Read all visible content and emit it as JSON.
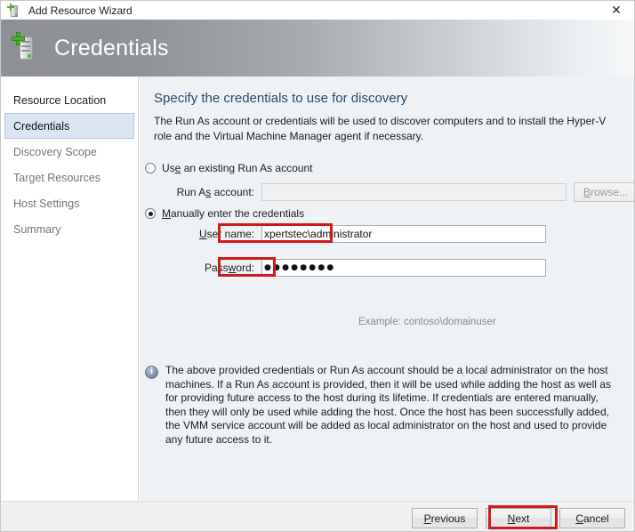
{
  "titlebar": {
    "title": "Add Resource Wizard",
    "icon": "server-add-icon",
    "close_label": "✕"
  },
  "header": {
    "title": "Credentials",
    "icon": "server-add-icon"
  },
  "sidebar": {
    "items": [
      {
        "label": "Resource Location",
        "state": "done"
      },
      {
        "label": "Credentials",
        "state": "selected"
      },
      {
        "label": "Discovery Scope",
        "state": "upcoming"
      },
      {
        "label": "Target Resources",
        "state": "upcoming"
      },
      {
        "label": "Host Settings",
        "state": "upcoming"
      },
      {
        "label": "Summary",
        "state": "upcoming"
      }
    ]
  },
  "main": {
    "heading": "Specify the credentials to use for discovery",
    "description": "The Run As account or credentials will be used to discover computers and to install the Hyper-V role and the Virtual Machine Manager agent if necessary.",
    "option_existing": {
      "label_before": "Us",
      "label_accel": "e",
      "label_after": " an existing Run As account",
      "checked": false
    },
    "runas": {
      "label_before": "Run A",
      "label_accel": "s",
      "label_after": " account:",
      "value": "",
      "placeholder": "",
      "disabled": true,
      "browse_label_accel": "B",
      "browse_label_after": "rowse..."
    },
    "option_manual": {
      "label_accel": "M",
      "label_after": "anually enter the credentials",
      "checked": true
    },
    "username": {
      "label_accel": "U",
      "label_after": "ser name:",
      "value": "xpertstec\\administrator",
      "example": "Example: contoso\\domainuser"
    },
    "password": {
      "label_before": "Pass",
      "label_accel": "w",
      "label_after": "ord:",
      "masked_value": "●●●●●●●●",
      "char_count": 8
    },
    "info": {
      "icon": "info-icon",
      "text": "The above provided credentials or Run As account should be a local administrator on the host machines. If a Run As account is provided, then it will be used while adding the host as well as for providing future access to the host during its lifetime. If credentials are entered manually, then they will only be used while adding the host. Once the host has been successfully added, the VMM service account will be added as local administrator on the host and used to provide any future access to it."
    }
  },
  "footer": {
    "previous": {
      "accel": "P",
      "rest": "revious"
    },
    "next": {
      "accel": "N",
      "rest": "ext"
    },
    "cancel": {
      "accel": "C",
      "rest": "ancel"
    }
  },
  "annotations": {
    "accent_color": "#d01a1a",
    "highlighted": [
      "username-value",
      "password-value",
      "next-button"
    ]
  }
}
